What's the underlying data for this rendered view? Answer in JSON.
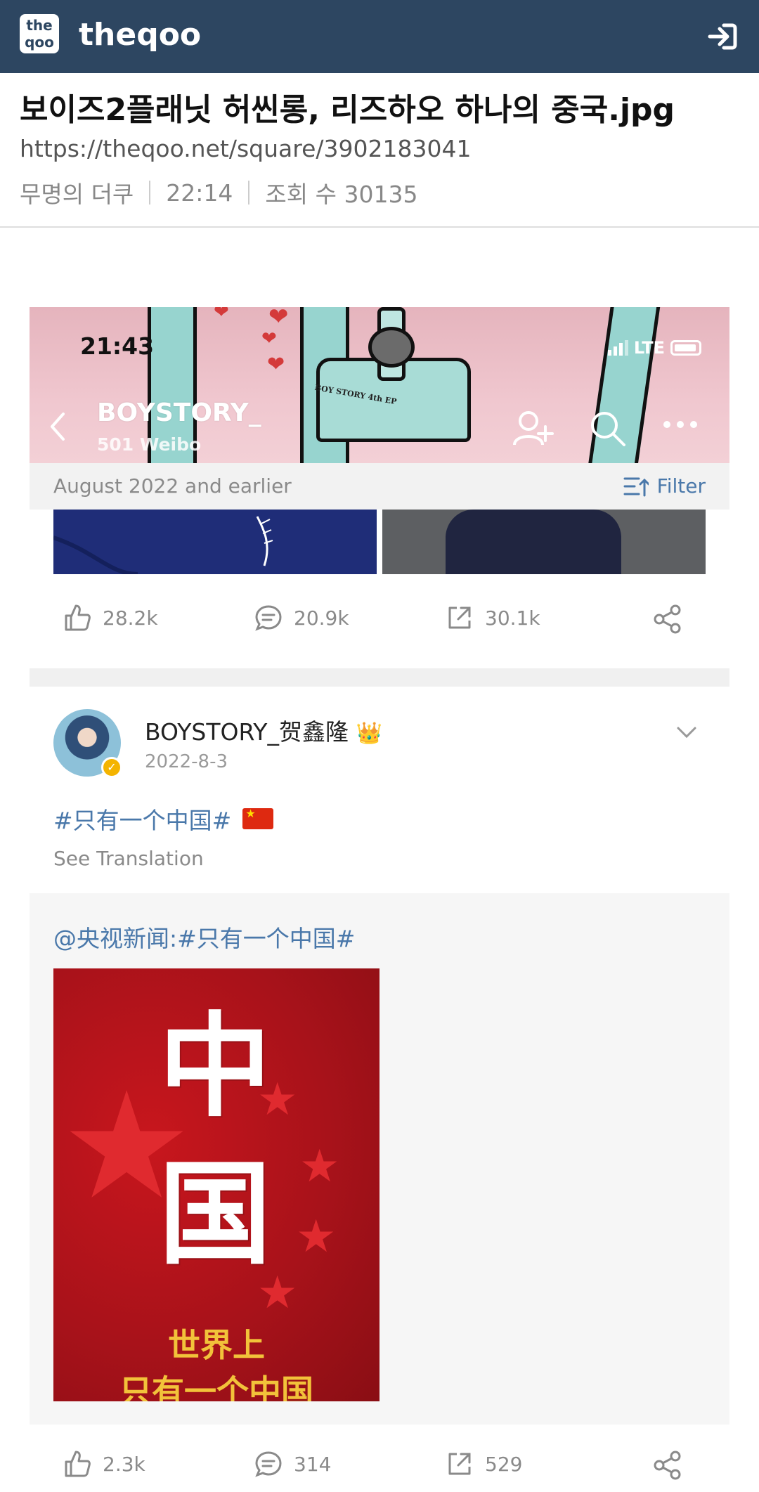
{
  "app": {
    "logo_text": "the qoo",
    "brand": "theqoo"
  },
  "post": {
    "title": "보이즈2플래닛 허씬롱, 리즈하오 하나의 중국.jpg",
    "url": "https://theqoo.net/square/3902183041",
    "author": "무명의 더쿠",
    "time": "22:14",
    "views_label": "조회 수 30135"
  },
  "weibo": {
    "status_time": "21:43",
    "network": "LTE",
    "account_name": "BOYSTORY_",
    "account_sub": "501 Weibo",
    "artwork_text": "BOY STORY 4th EP",
    "filter_period": "August 2022 and earlier",
    "filter_label": "Filter",
    "first_post_actions": {
      "likes": "28.2k",
      "comments": "20.9k",
      "reposts": "30.1k"
    },
    "post": {
      "poster_name": "BOYSTORY_贺鑫隆",
      "date": "2022-8-3",
      "text": "#只有一个中国#",
      "see_translation": "See Translation",
      "repost_text": "@央视新闻:#只有一个中国#",
      "image_big_chars": [
        "中",
        "国"
      ],
      "image_caption_1": "世界上",
      "image_caption_2": "只有一个中国",
      "actions": {
        "likes": "2.3k",
        "comments": "314",
        "reposts": "529"
      }
    }
  },
  "colors": {
    "topbar": "#2d4661",
    "link_blue": "#4a78aa",
    "gray_text": "#8a8a8a",
    "poster_red": "#c8161d",
    "gold": "#f2c23a"
  }
}
